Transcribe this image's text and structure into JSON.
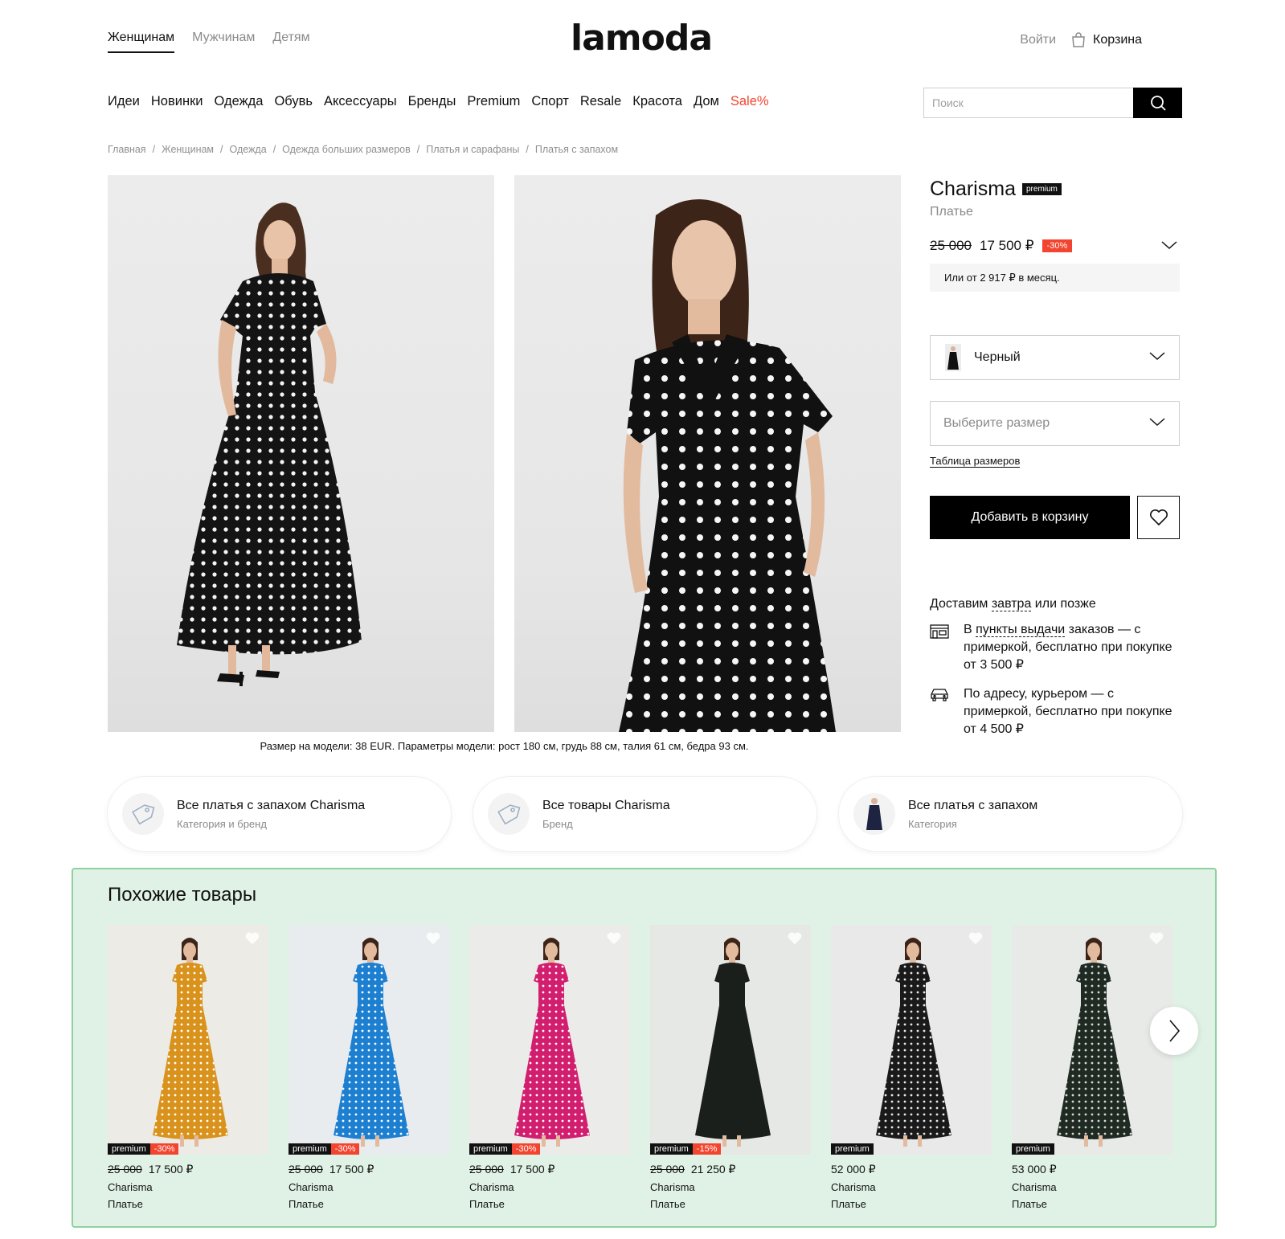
{
  "header": {
    "gender_tabs": [
      {
        "label": "Женщинам",
        "active": true
      },
      {
        "label": "Мужчинам",
        "active": false
      },
      {
        "label": "Детям",
        "active": false
      }
    ],
    "logo_text": "lamoda",
    "login_label": "Войти",
    "cart_label": "Корзина"
  },
  "nav": {
    "items": [
      "Идеи",
      "Новинки",
      "Одежда",
      "Обувь",
      "Аксессуары",
      "Бренды",
      "Premium",
      "Спорт",
      "Resale",
      "Красота",
      "Дом",
      "Sale%"
    ],
    "sale_color": "#f2442e"
  },
  "search": {
    "placeholder": "Поиск",
    "button_icon": "search-icon"
  },
  "breadcrumbs": [
    "Главная",
    "Женщинам",
    "Одежда",
    "Одежда больших размеров",
    "Платья и сарафаны",
    "Платья с запахом"
  ],
  "gallery": {
    "images": [
      "full-length model photo, black polka-dot wrap dress",
      "close-up model photo, black polka-dot wrap dress"
    ],
    "model_caption": "Размер на модели: 38 EUR. Параметры модели: рост 180 см, грудь 88 см, талия 61 см, бедра 93 см."
  },
  "product": {
    "brand": "Charisma",
    "premium_badge": "premium",
    "type": "Платье",
    "old_price": "25 000",
    "new_price": "17 500 ₽",
    "discount": "-30%",
    "installment": "Или от 2 917 ₽ в месяц.",
    "color_label": "Черный",
    "size_placeholder": "Выберите размер",
    "size_table_label": "Таблица размеров",
    "add_to_cart_label": "Добавить в корзину",
    "accent_color": "#f2442e"
  },
  "delivery": {
    "title_before": "Доставим ",
    "title_link": "завтра",
    "title_after": " или позже",
    "pickup": {
      "before": "В ",
      "link": "пункты выдачи",
      "after": " заказов — с примеркой, бесплатно при покупке от 3 500 ₽"
    },
    "courier": {
      "text": "По адресу, курьером — с примеркой, бесплатно при покупке от 4 500 ₽"
    }
  },
  "related": [
    {
      "title": "Все платья с запахом Charisma",
      "subtitle": "Категория и бренд",
      "icon": "tag-icon"
    },
    {
      "title": "Все товары Charisma",
      "subtitle": "Бренд",
      "icon": "tag-icon"
    },
    {
      "title": "Все платья с запахом",
      "subtitle": "Категория",
      "icon": "dress-thumbnail"
    }
  ],
  "similar": {
    "title": "Похожие товары",
    "products": [
      {
        "old_price": "25 000",
        "price": "17 500 ₽",
        "brand": "Charisma",
        "type": "Платье",
        "premium": "premium",
        "discount": "-30%",
        "dress_color": "#d9931c",
        "dot_color": "#ffffff",
        "bg": "#ecebe6"
      },
      {
        "old_price": "25 000",
        "price": "17 500 ₽",
        "brand": "Charisma",
        "type": "Платье",
        "premium": "premium",
        "discount": "-30%",
        "dress_color": "#1d7fd0",
        "dot_color": "#ffffff",
        "bg": "#e8ecef"
      },
      {
        "old_price": "25 000",
        "price": "17 500 ₽",
        "brand": "Charisma",
        "type": "Платье",
        "premium": "premium",
        "discount": "-30%",
        "dress_color": "#d21e6e",
        "dot_color": "#ffffff",
        "bg": "#ebebea"
      },
      {
        "old_price": "25 000",
        "price": "21 250 ₽",
        "brand": "Charisma",
        "type": "Платье",
        "premium": "premium",
        "discount": "-15%",
        "dress_color": "#1b1f1b",
        "dot_color": "#1b1f1b",
        "bg": "#e6e8e5"
      },
      {
        "old_price": "",
        "price": "52 000 ₽",
        "brand": "Charisma",
        "type": "Платье",
        "premium": "premium",
        "discount": "",
        "dress_color": "#1a1a1a",
        "dot_color": "#e8e8e8",
        "bg": "#e9e9e9"
      },
      {
        "old_price": "",
        "price": "53 000 ₽",
        "brand": "Charisma",
        "type": "Платье",
        "premium": "premium",
        "discount": "",
        "dress_color": "#1f2a22",
        "dot_color": "#d8d8d8",
        "bg": "#e8eae7"
      }
    ]
  }
}
